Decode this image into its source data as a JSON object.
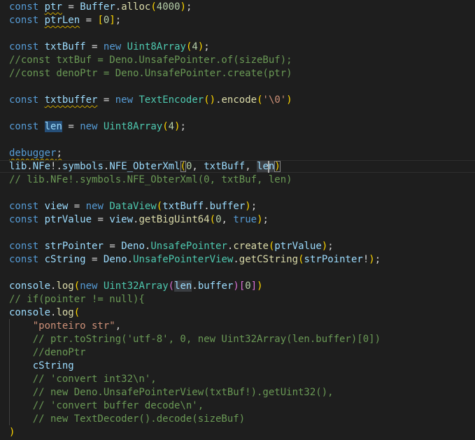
{
  "editor": {
    "language": "javascript",
    "theme": "dark",
    "colors": {
      "background": "#1e1e1e",
      "keyword": "#569cd6",
      "variable": "#9cdcfe",
      "function": "#dcdcaa",
      "class": "#4ec9b0",
      "number": "#b5cea8",
      "string": "#ce9178",
      "comment": "#6a9955",
      "bracket_1": "#ffd700",
      "bracket_2": "#da70d6",
      "bracket_3": "#179fff",
      "warning_squiggle": "#cca700"
    },
    "lines": [
      {
        "tokens": [
          {
            "t": "const",
            "c": "k"
          },
          {
            "t": " ",
            "c": "p"
          },
          {
            "t": "ptr",
            "c": "v",
            "sq": true
          },
          {
            "t": " = ",
            "c": "p"
          },
          {
            "t": "Buffer",
            "c": "v"
          },
          {
            "t": ".",
            "c": "p"
          },
          {
            "t": "alloc",
            "c": "f"
          },
          {
            "t": "(",
            "c": "b1"
          },
          {
            "t": "4000",
            "c": "n"
          },
          {
            "t": ")",
            "c": "b1"
          },
          {
            "t": ";",
            "c": "p"
          }
        ]
      },
      {
        "tokens": [
          {
            "t": "const",
            "c": "k"
          },
          {
            "t": " ",
            "c": "p"
          },
          {
            "t": "ptrLen",
            "c": "v",
            "sq": true
          },
          {
            "t": " = ",
            "c": "p"
          },
          {
            "t": "[",
            "c": "b1"
          },
          {
            "t": "0",
            "c": "n"
          },
          {
            "t": "]",
            "c": "b1"
          },
          {
            "t": ";",
            "c": "p"
          }
        ]
      },
      {
        "tokens": []
      },
      {
        "tokens": [
          {
            "t": "const",
            "c": "k"
          },
          {
            "t": " ",
            "c": "p"
          },
          {
            "t": "txtBuff",
            "c": "v"
          },
          {
            "t": " = ",
            "c": "p"
          },
          {
            "t": "new",
            "c": "k"
          },
          {
            "t": " ",
            "c": "p"
          },
          {
            "t": "Uint8Array",
            "c": "c"
          },
          {
            "t": "(",
            "c": "b1"
          },
          {
            "t": "4",
            "c": "n"
          },
          {
            "t": ")",
            "c": "b1"
          },
          {
            "t": ";",
            "c": "p"
          }
        ]
      },
      {
        "tokens": [
          {
            "t": "//const txtBuf = Deno.UnsafePointer.of(sizeBuf);",
            "c": "cm"
          }
        ]
      },
      {
        "tokens": [
          {
            "t": "//const denoPtr = Deno.UnsafePointer.create(ptr)",
            "c": "cm"
          }
        ]
      },
      {
        "tokens": []
      },
      {
        "tokens": [
          {
            "t": "const",
            "c": "k"
          },
          {
            "t": " ",
            "c": "p"
          },
          {
            "t": "txtbuffer",
            "c": "v",
            "sq": true
          },
          {
            "t": " = ",
            "c": "p"
          },
          {
            "t": "new",
            "c": "k"
          },
          {
            "t": " ",
            "c": "p"
          },
          {
            "t": "TextEncoder",
            "c": "c"
          },
          {
            "t": "()",
            "c": "b1"
          },
          {
            "t": ".",
            "c": "p"
          },
          {
            "t": "encode",
            "c": "f"
          },
          {
            "t": "(",
            "c": "b1"
          },
          {
            "t": "'\\0'",
            "c": "s"
          },
          {
            "t": ")",
            "c": "b1"
          }
        ]
      },
      {
        "tokens": []
      },
      {
        "tokens": [
          {
            "t": "const",
            "c": "k"
          },
          {
            "t": " ",
            "c": "p"
          },
          {
            "t": "len",
            "c": "v",
            "hl": "hl"
          },
          {
            "t": " = ",
            "c": "p"
          },
          {
            "t": "new",
            "c": "k"
          },
          {
            "t": " ",
            "c": "p"
          },
          {
            "t": "Uint8Array",
            "c": "c"
          },
          {
            "t": "(",
            "c": "b1"
          },
          {
            "t": "4",
            "c": "n"
          },
          {
            "t": ")",
            "c": "b1"
          },
          {
            "t": ";",
            "c": "p"
          }
        ]
      },
      {
        "tokens": []
      },
      {
        "tokens": [
          {
            "t": "debugger",
            "c": "k",
            "sq": true
          },
          {
            "t": ";",
            "c": "p",
            "sq": true
          }
        ]
      },
      {
        "current": true,
        "tokens": [
          {
            "t": "lib",
            "c": "v"
          },
          {
            "t": ".",
            "c": "p"
          },
          {
            "t": "NFe",
            "c": "v"
          },
          {
            "t": "!.",
            "c": "p"
          },
          {
            "t": "symbols",
            "c": "v"
          },
          {
            "t": ".",
            "c": "p"
          },
          {
            "t": "NFE_ObterXml",
            "c": "v"
          },
          {
            "t": "(",
            "c": "b1",
            "hl": "bm"
          },
          {
            "t": "0",
            "c": "n"
          },
          {
            "t": ", ",
            "c": "p"
          },
          {
            "t": "txtBuff",
            "c": "v"
          },
          {
            "t": ", ",
            "c": "p"
          },
          {
            "t": "len",
            "c": "v",
            "hl": "hl2"
          },
          {
            "t": ")",
            "c": "b1",
            "hl": "bm"
          }
        ]
      },
      {
        "tokens": [
          {
            "t": "// lib.NFe!.symbols.NFE_ObterXml(0, txtBuf, len)",
            "c": "cm"
          }
        ]
      },
      {
        "tokens": []
      },
      {
        "tokens": [
          {
            "t": "const",
            "c": "k"
          },
          {
            "t": " ",
            "c": "p"
          },
          {
            "t": "view",
            "c": "v"
          },
          {
            "t": " = ",
            "c": "p"
          },
          {
            "t": "new",
            "c": "k"
          },
          {
            "t": " ",
            "c": "p"
          },
          {
            "t": "DataView",
            "c": "c"
          },
          {
            "t": "(",
            "c": "b1"
          },
          {
            "t": "txtBuff",
            "c": "v"
          },
          {
            "t": ".",
            "c": "p"
          },
          {
            "t": "buffer",
            "c": "v"
          },
          {
            "t": ")",
            "c": "b1"
          },
          {
            "t": ";",
            "c": "p"
          }
        ]
      },
      {
        "tokens": [
          {
            "t": "const",
            "c": "k"
          },
          {
            "t": " ",
            "c": "p"
          },
          {
            "t": "ptrValue",
            "c": "v"
          },
          {
            "t": " = ",
            "c": "p"
          },
          {
            "t": "view",
            "c": "v"
          },
          {
            "t": ".",
            "c": "p"
          },
          {
            "t": "getBigUint64",
            "c": "f"
          },
          {
            "t": "(",
            "c": "b1"
          },
          {
            "t": "0",
            "c": "n"
          },
          {
            "t": ", ",
            "c": "p"
          },
          {
            "t": "true",
            "c": "k"
          },
          {
            "t": ")",
            "c": "b1"
          },
          {
            "t": ";",
            "c": "p"
          }
        ]
      },
      {
        "tokens": []
      },
      {
        "tokens": [
          {
            "t": "const",
            "c": "k"
          },
          {
            "t": " ",
            "c": "p"
          },
          {
            "t": "strPointer",
            "c": "v"
          },
          {
            "t": " = ",
            "c": "p"
          },
          {
            "t": "Deno",
            "c": "v"
          },
          {
            "t": ".",
            "c": "p"
          },
          {
            "t": "UnsafePointer",
            "c": "c"
          },
          {
            "t": ".",
            "c": "p"
          },
          {
            "t": "create",
            "c": "f"
          },
          {
            "t": "(",
            "c": "b1"
          },
          {
            "t": "ptrValue",
            "c": "v"
          },
          {
            "t": ")",
            "c": "b1"
          },
          {
            "t": ";",
            "c": "p"
          }
        ]
      },
      {
        "tokens": [
          {
            "t": "const",
            "c": "k"
          },
          {
            "t": " ",
            "c": "p"
          },
          {
            "t": "cString",
            "c": "v"
          },
          {
            "t": " = ",
            "c": "p"
          },
          {
            "t": "Deno",
            "c": "v"
          },
          {
            "t": ".",
            "c": "p"
          },
          {
            "t": "UnsafePointerView",
            "c": "c"
          },
          {
            "t": ".",
            "c": "p"
          },
          {
            "t": "getCString",
            "c": "f"
          },
          {
            "t": "(",
            "c": "b1"
          },
          {
            "t": "strPointer",
            "c": "v"
          },
          {
            "t": "!",
            "c": "p"
          },
          {
            "t": ")",
            "c": "b1"
          },
          {
            "t": ";",
            "c": "p"
          }
        ]
      },
      {
        "tokens": []
      },
      {
        "tokens": [
          {
            "t": "console",
            "c": "v"
          },
          {
            "t": ".",
            "c": "p"
          },
          {
            "t": "log",
            "c": "f"
          },
          {
            "t": "(",
            "c": "b1"
          },
          {
            "t": "new",
            "c": "k"
          },
          {
            "t": " ",
            "c": "p"
          },
          {
            "t": "Uint32Array",
            "c": "c"
          },
          {
            "t": "(",
            "c": "b2"
          },
          {
            "t": "len",
            "c": "v",
            "hl": "hl2"
          },
          {
            "t": ".",
            "c": "p"
          },
          {
            "t": "buffer",
            "c": "v"
          },
          {
            "t": ")",
            "c": "b2"
          },
          {
            "t": "[",
            "c": "b2"
          },
          {
            "t": "0",
            "c": "n"
          },
          {
            "t": "]",
            "c": "b2"
          },
          {
            "t": ")",
            "c": "b1"
          }
        ]
      },
      {
        "tokens": [
          {
            "t": "// if(pointer != null){",
            "c": "cm"
          }
        ]
      },
      {
        "tokens": [
          {
            "t": "console",
            "c": "v"
          },
          {
            "t": ".",
            "c": "p"
          },
          {
            "t": "log",
            "c": "f"
          },
          {
            "t": "(",
            "c": "b1"
          }
        ]
      },
      {
        "tokens": [
          {
            "t": "    ",
            "c": "p"
          },
          {
            "t": "\"ponteiro str\"",
            "c": "s"
          },
          {
            "t": ",",
            "c": "p"
          }
        ]
      },
      {
        "tokens": [
          {
            "t": "    // ptr.toString('utf-8', 0, new Uint32Array(len.buffer)[0])",
            "c": "cm"
          }
        ]
      },
      {
        "tokens": [
          {
            "t": "    //denoPtr",
            "c": "cm"
          }
        ]
      },
      {
        "tokens": [
          {
            "t": "    ",
            "c": "p"
          },
          {
            "t": "cString",
            "c": "v"
          }
        ]
      },
      {
        "tokens": [
          {
            "t": "    // 'convert int32\\n',",
            "c": "cm"
          }
        ]
      },
      {
        "tokens": [
          {
            "t": "    // new Deno.UnsafePointerView(txtBuf!).getUint32(),",
            "c": "cm"
          }
        ]
      },
      {
        "tokens": [
          {
            "t": "    // 'convert buffer decode\\n',",
            "c": "cm"
          }
        ]
      },
      {
        "tokens": [
          {
            "t": "    // new TextDecoder().decode(sizeBuf)",
            "c": "cm"
          }
        ]
      },
      {
        "tokens": [
          {
            "t": ")",
            "c": "b1"
          }
        ]
      }
    ]
  }
}
